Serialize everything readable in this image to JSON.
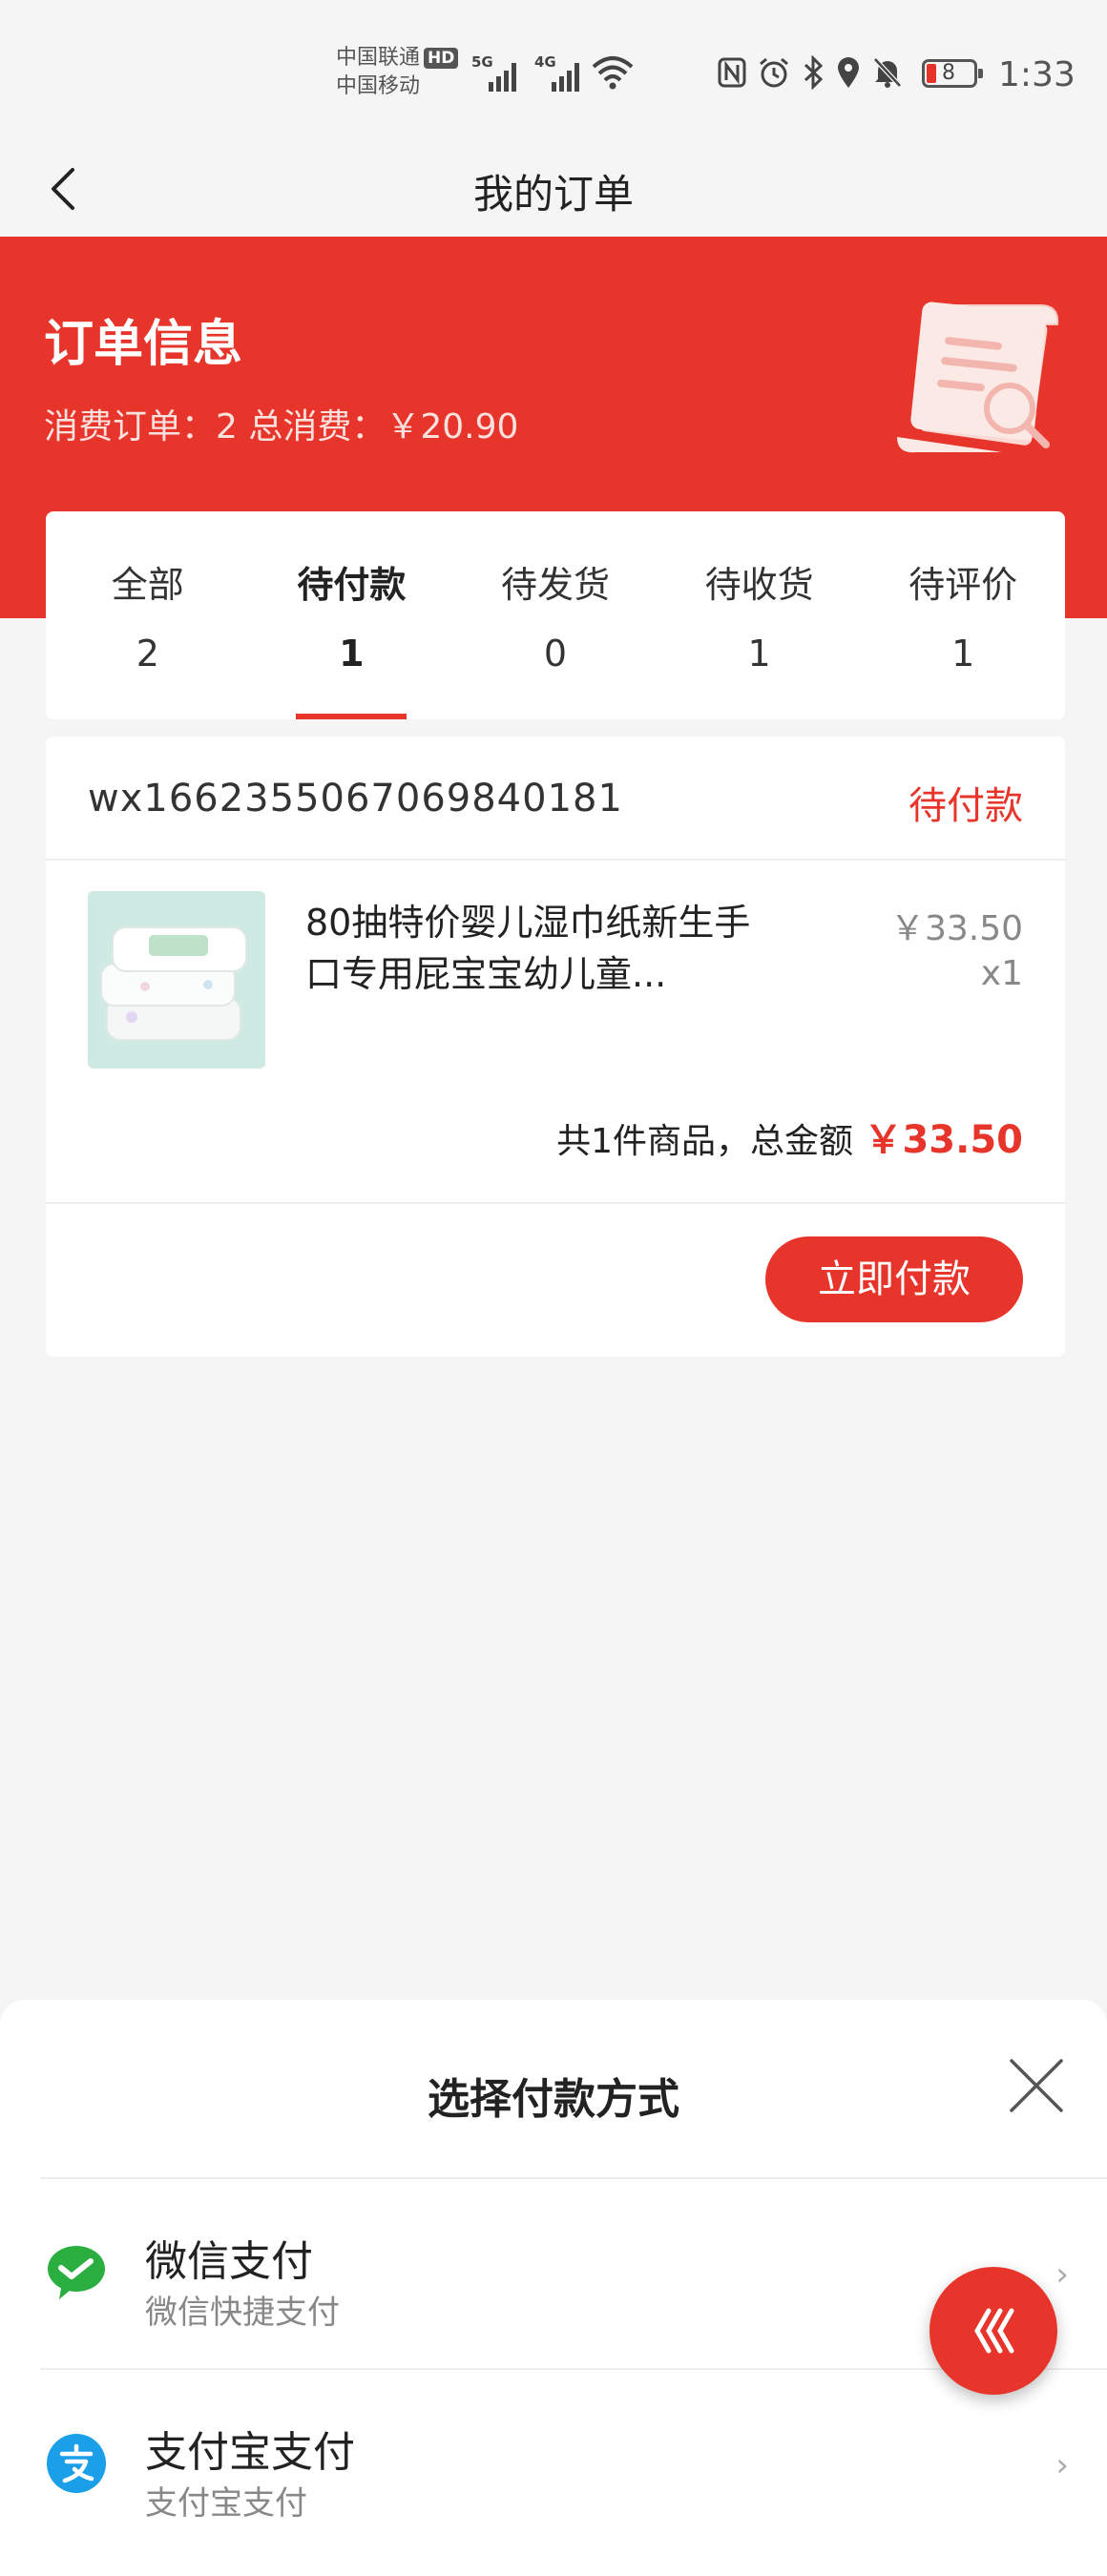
{
  "status_bar": {
    "carrier1": "中国联通",
    "hd_badge": "HD",
    "carrier2": "中国移动",
    "signal1_label": "5G",
    "signal2_label": "4G",
    "battery_level": "8",
    "time": "1:33",
    "icons": [
      "nfc-icon",
      "alarm-icon",
      "bluetooth-icon",
      "location-icon",
      "mute-icon"
    ]
  },
  "nav": {
    "title": "我的订单",
    "back_icon": "chevron-left-icon"
  },
  "header": {
    "title": "订单信息",
    "summary": "消费订单：2 总消费：￥20.90",
    "accent_color": "#e7352b"
  },
  "tabs": [
    {
      "label": "全部",
      "count": "2",
      "active": false
    },
    {
      "label": "待付款",
      "count": "1",
      "active": true
    },
    {
      "label": "待发货",
      "count": "0",
      "active": false
    },
    {
      "label": "待收货",
      "count": "1",
      "active": false
    },
    {
      "label": "待评价",
      "count": "1",
      "active": false
    }
  ],
  "order": {
    "id": "wx1662355067069840181",
    "status": "待付款",
    "product_name": "80抽特价婴儿湿巾纸新生手口专用屁宝宝幼儿童...",
    "price": "￥33.50",
    "qty": "x1",
    "total_prefix": "共1件商品，总金额",
    "total_amount": "￥33.50",
    "pay_button": "立即付款"
  },
  "payment_sheet": {
    "title": "选择付款方式",
    "options": [
      {
        "name": "微信支付",
        "desc": "微信快捷支付",
        "icon": "wechat-pay-icon",
        "color": "#2aae3f"
      },
      {
        "name": "支付宝支付",
        "desc": "支付宝支付",
        "icon": "alipay-icon",
        "color": "#1a9fe8"
      }
    ]
  }
}
